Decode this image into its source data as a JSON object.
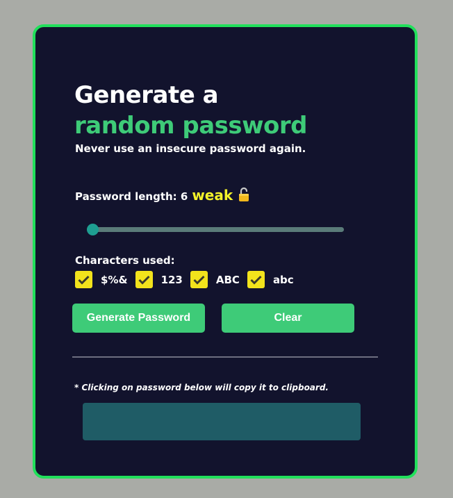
{
  "heading": {
    "line1": "Generate a",
    "line2": "random password",
    "subtitle": "Never use an insecure password again."
  },
  "length": {
    "label": "Password length: 6",
    "strength": "weak",
    "value": 6,
    "slider_fraction": 0.0
  },
  "characters": {
    "label": "Characters used:",
    "options": [
      {
        "label": "$%&",
        "checked": true
      },
      {
        "label": "123",
        "checked": true
      },
      {
        "label": "ABC",
        "checked": true
      },
      {
        "label": "abc",
        "checked": true
      }
    ]
  },
  "buttons": {
    "generate": "Generate Password",
    "clear": "Clear"
  },
  "note": "* Clicking on password below will copy it to clipboard.",
  "output": {
    "value": ""
  },
  "colors": {
    "card_bg": "#12132d",
    "card_border": "#21e05b",
    "accent": "#3ecb78",
    "strength_weak": "#f2f22a",
    "checkbox": "#f2e31c",
    "output_bg": "#1f5c66"
  },
  "icons": {
    "strength": "open-lock-icon",
    "checkbox": "check-icon"
  }
}
